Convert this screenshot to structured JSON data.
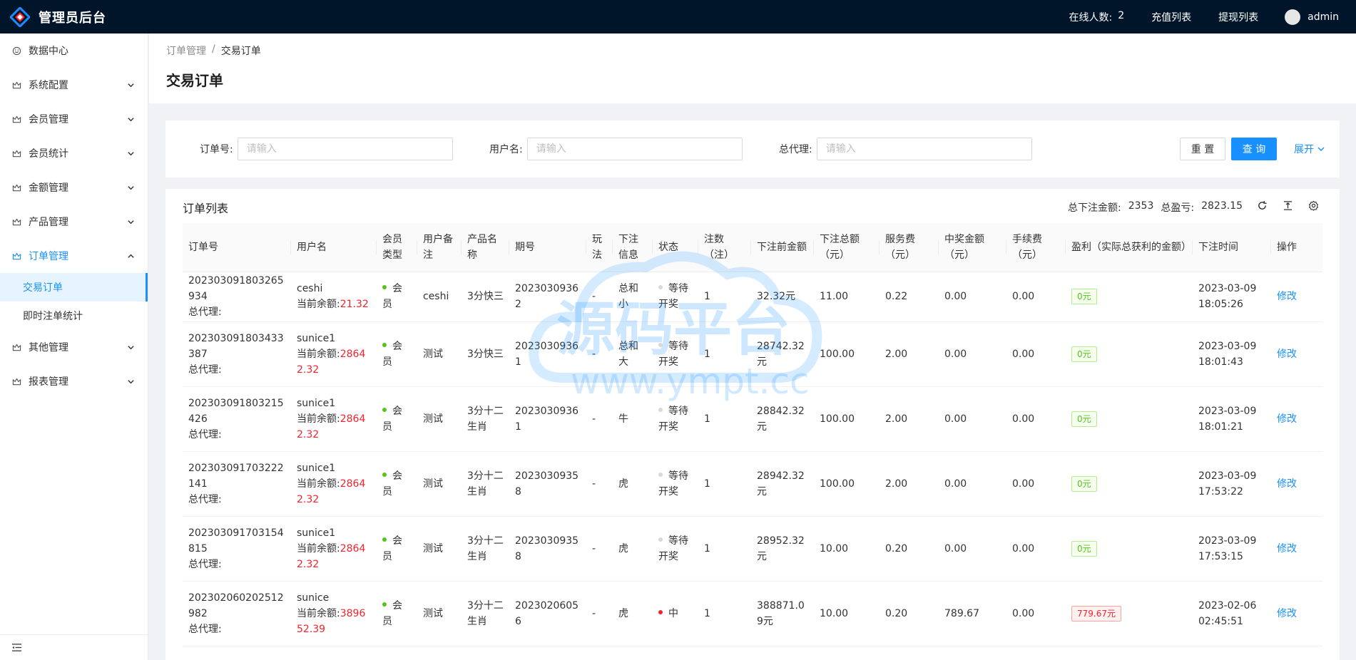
{
  "app": {
    "title": "管理员后台"
  },
  "header": {
    "online_label": "在线人数:",
    "online_count": "2",
    "recharge_label": "充值列表",
    "withdraw_label": "提现列表",
    "username": "admin"
  },
  "sidebar": {
    "items": [
      {
        "label": "数据中心"
      },
      {
        "label": "系统配置"
      },
      {
        "label": "会员管理"
      },
      {
        "label": "会员统计"
      },
      {
        "label": "金额管理"
      },
      {
        "label": "产品管理"
      },
      {
        "label": "订单管理"
      },
      {
        "label": "其他管理"
      },
      {
        "label": "报表管理"
      }
    ],
    "sub_items": [
      {
        "label": "交易订单"
      },
      {
        "label": "即时注单统计"
      }
    ]
  },
  "breadcrumb": {
    "parent": "订单管理",
    "sep": "/",
    "current": "交易订单"
  },
  "page": {
    "title": "交易订单"
  },
  "search": {
    "order_label": "订单号:",
    "user_label": "用户名:",
    "agent_label": "总代理:",
    "placeholder": "请输入",
    "reset_label": "重 置",
    "query_label": "查 询",
    "expand_label": "展开"
  },
  "table": {
    "title": "订单列表",
    "total_bet_label": "总下注金额:",
    "total_bet_value": "2353",
    "total_profit_label": "总盈亏:",
    "total_profit_value": "2823.15",
    "columns": [
      "订单号",
      "用户名",
      "会员类型",
      "用户备注",
      "产品名称",
      "期号",
      "玩法",
      "下注信息",
      "状态",
      "注数（注）",
      "下注前金额",
      "下注总额（元）",
      "服务费（元）",
      "中奖金额（元）",
      "手续费（元）",
      "盈利（实际总获利的金额）",
      "下注时间",
      "操作"
    ],
    "agent_label": "总代理:",
    "balance_label": "当前余额:",
    "edit_label": "修改",
    "rows": [
      {
        "order": "202303091803265934",
        "user": "ceshi",
        "balance": "21.32",
        "type": "会员",
        "note": "ceshi",
        "product": "3分快三",
        "issue": "20230309362",
        "play": "-",
        "bet": "总和小",
        "status": "等待开奖",
        "count": "1",
        "before": "32.32元",
        "total": "11.00",
        "fee": "0.22",
        "win": "0.00",
        "charge": "0.00",
        "profit": "0元",
        "time": "2023-03-09 18:05:26"
      },
      {
        "order": "202303091803433387",
        "user": "sunice1",
        "balance": "28642.32",
        "type": "会员",
        "note": "测试",
        "product": "3分快三",
        "issue": "20230309361",
        "play": "-",
        "bet": "总和大",
        "status": "等待开奖",
        "count": "1",
        "before": "28742.32元",
        "total": "100.00",
        "fee": "2.00",
        "win": "0.00",
        "charge": "0.00",
        "profit": "0元",
        "time": "2023-03-09 18:01:43"
      },
      {
        "order": "202303091803215426",
        "user": "sunice1",
        "balance": "28642.32",
        "type": "会员",
        "note": "测试",
        "product": "3分十二生肖",
        "issue": "20230309361",
        "play": "-",
        "bet": "牛",
        "status": "等待开奖",
        "count": "1",
        "before": "28842.32元",
        "total": "100.00",
        "fee": "2.00",
        "win": "0.00",
        "charge": "0.00",
        "profit": "0元",
        "time": "2023-03-09 18:01:21"
      },
      {
        "order": "202303091703222141",
        "user": "sunice1",
        "balance": "28642.32",
        "type": "会员",
        "note": "测试",
        "product": "3分十二生肖",
        "issue": "20230309358",
        "play": "-",
        "bet": "虎",
        "status": "等待开奖",
        "count": "1",
        "before": "28942.32元",
        "total": "100.00",
        "fee": "2.00",
        "win": "0.00",
        "charge": "0.00",
        "profit": "0元",
        "time": "2023-03-09 17:53:22"
      },
      {
        "order": "202303091703154815",
        "user": "sunice1",
        "balance": "28642.32",
        "type": "会员",
        "note": "测试",
        "product": "3分十二生肖",
        "issue": "20230309358",
        "play": "-",
        "bet": "虎",
        "status": "等待开奖",
        "count": "1",
        "before": "28952.32元",
        "total": "10.00",
        "fee": "0.20",
        "win": "0.00",
        "charge": "0.00",
        "profit": "0元",
        "time": "2023-03-09 17:53:15"
      },
      {
        "order": "202302060202512982",
        "user": "sunice",
        "balance": "389652.39",
        "type": "会员",
        "note": "测试",
        "product": "3分十二生肖",
        "issue": "20230206056",
        "play": "-",
        "bet": "虎",
        "status": "中",
        "count": "1",
        "before": "388871.09元",
        "total": "10.00",
        "fee": "0.20",
        "win": "789.67",
        "charge": "0.00",
        "profit": "779.67元",
        "time": "2023-02-06 02:45:51"
      }
    ]
  },
  "watermark": {
    "title": "源码平台",
    "url": "www.ympt.cc"
  },
  "colors": {
    "header_bg": "#001529",
    "primary": "#1890ff",
    "red": "#f5222d",
    "green": "#52c41a"
  }
}
